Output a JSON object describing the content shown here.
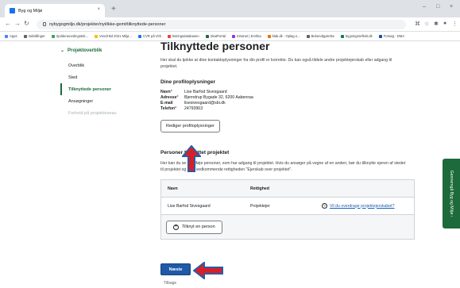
{
  "browser": {
    "tab_title": "Byg og Miljø",
    "tab_close": "×",
    "new_tab": "+",
    "win_min": "–",
    "win_max": "□",
    "win_close": "×",
    "url": "nybygogmiljo.dk/projekter/nyt/ikke-gemt/tilknyttede-personer",
    "bookmarks": [
      "Apps",
      "Indstillinger",
      "Sjolderavordingstek...",
      "Vendt Bd 2021 Miljø...",
      "CVR på Virk",
      "Boringsdatabasen",
      "SkatPortal",
      "Intranet | Ervhka",
      "klak.dk - Oplag.n...",
      "Bekendtgørelse",
      "bygningsreflekt.dk",
      "Forsøg - DMA"
    ]
  },
  "sidebar": {
    "section": "Projektoverblik",
    "items": [
      {
        "label": "Overblik",
        "state": "normal"
      },
      {
        "label": "Sted",
        "state": "normal"
      },
      {
        "label": "Tilknyttede personer",
        "state": "active"
      },
      {
        "label": "Ansøgninger",
        "state": "normal"
      },
      {
        "label": "Forhold på projektniveau",
        "state": "disabled"
      }
    ]
  },
  "main": {
    "title": "Tilknyttede personer",
    "intro": "Her skal du tjekke at dine kontaktoplysninger fra din profil er korrekte. Du kan også tildele andre projektejerskab eller adgang til projektet.",
    "profile": {
      "heading": "Dine profiloplysninger",
      "fields": [
        {
          "label": "Navn",
          "required": "*",
          "value": "Lise Barfod Sivesgaard"
        },
        {
          "label": "Adresse",
          "required": "*",
          "value": "Bjerndrup Bygade 32, 6200 Aabenraa"
        },
        {
          "label": "E-mail",
          "required": "",
          "value": "lisesivesgaard@sbi.dk"
        },
        {
          "label": "Telefon",
          "required": "*",
          "value": "24793963"
        }
      ],
      "edit_button": "Rediger profiloplysninger"
    },
    "persons": {
      "heading": "Personer tilknyttet projektet",
      "text": "Her kan du se og tilføje personer, som har adgang til projektet. Hvis du ansøger på vegne af en anden, bør du tilknytte ejeren af stedet til projektet og give vedkommende rettigheden \"Ejerskab over projektet\".",
      "col_name": "Navn",
      "col_right": "Rettighed",
      "rows": [
        {
          "name": "Lise Barfod Sivesgaard",
          "right": "Projektejer",
          "link": "Vil du overdrage projektejerskabet?"
        }
      ],
      "add_button": "Tilknyt en person",
      "help_icon": "?",
      "add_icon": "+"
    },
    "next_button": "Næste",
    "back_link": "Tilbage"
  },
  "feedback_tab": "Gennemgå Byg og Miljø ›",
  "colors": {
    "brand_green": "#1d6a3a",
    "primary_blue": "#1f5aa8",
    "annotation_red": "#d81f26",
    "annotation_blue": "#2a5ba8"
  }
}
